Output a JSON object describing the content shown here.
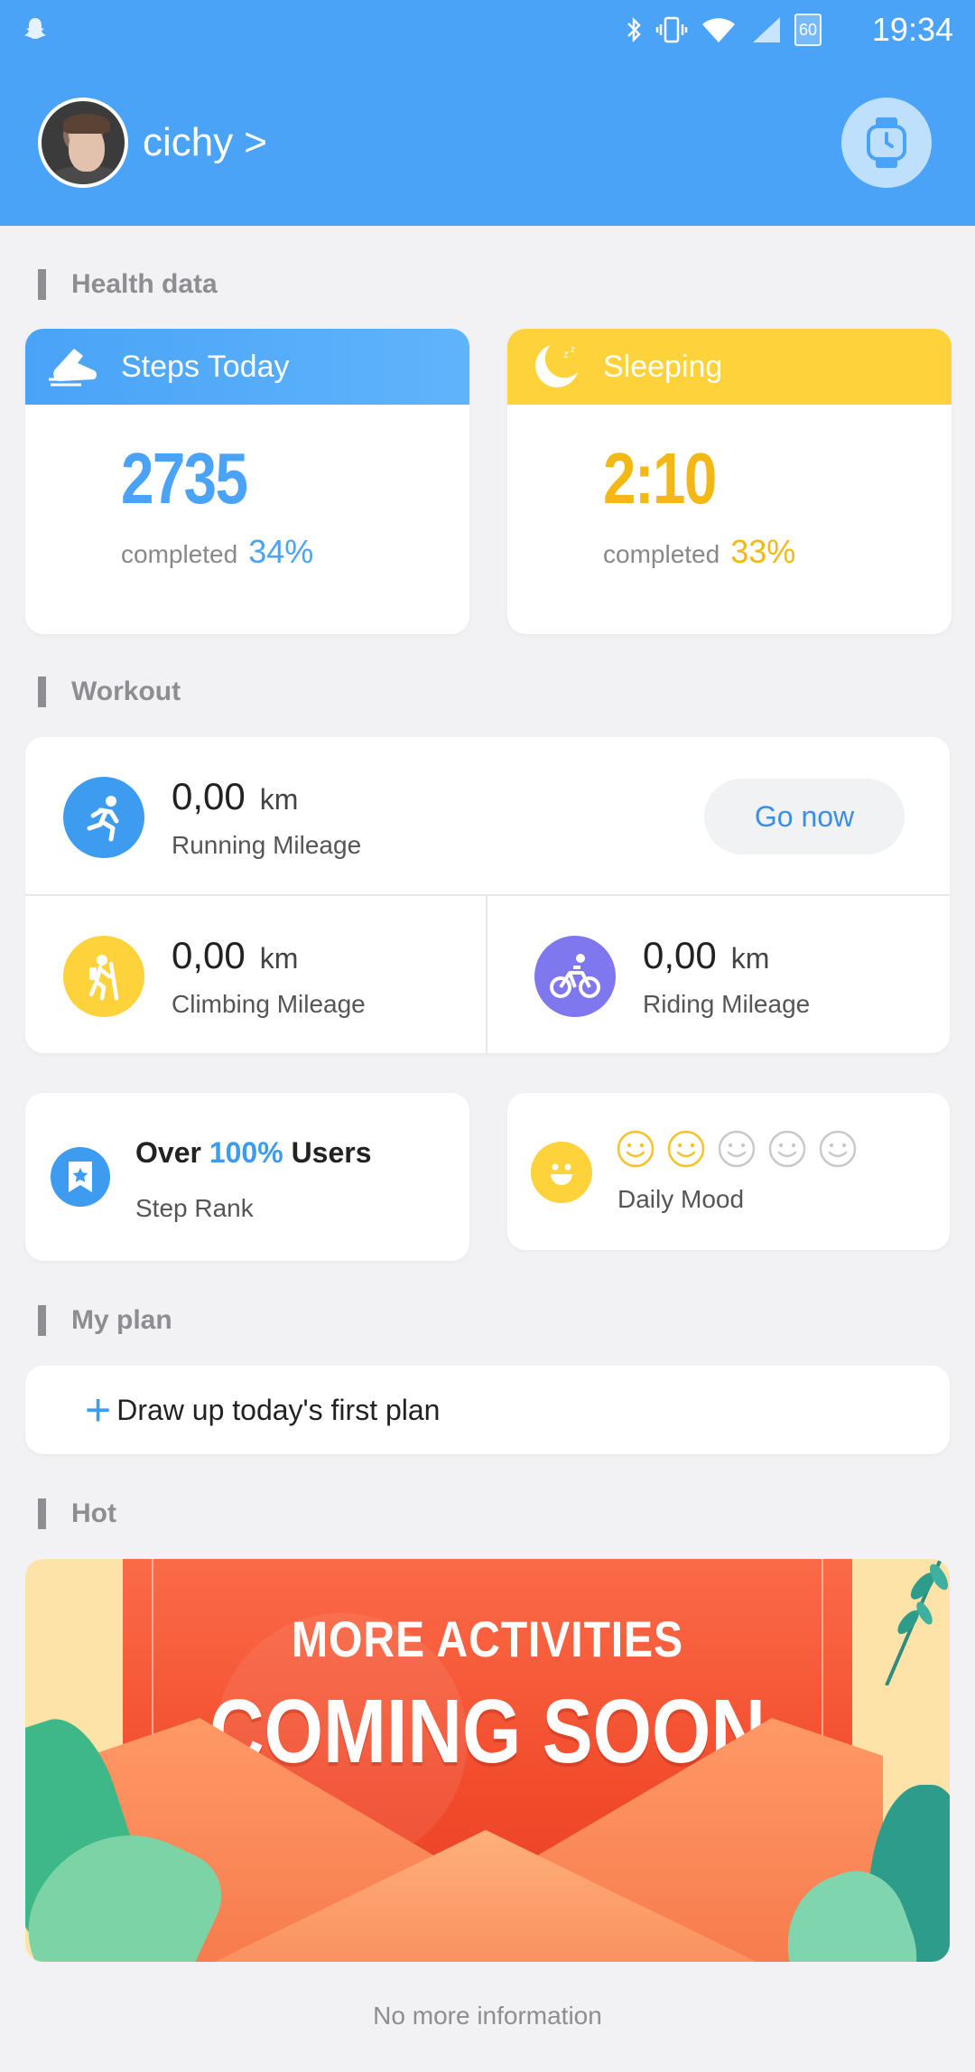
{
  "status_bar": {
    "time": "19:34",
    "battery": "60",
    "icons": [
      "snapchat-icon",
      "bluetooth-icon",
      "vibrate-icon",
      "wifi-icon",
      "signal-icon",
      "battery-icon"
    ]
  },
  "header": {
    "username": "cichy",
    "chevron": ">",
    "background_color": "#4aa3f7"
  },
  "sections": {
    "health": "Health data",
    "workout": "Workout",
    "plan": "My plan",
    "hot": "Hot"
  },
  "health": {
    "steps": {
      "title": "Steps Today",
      "value": "2735",
      "completed_label": "completed",
      "percent": "34%",
      "color": "#4aa3f7"
    },
    "sleep": {
      "title": "Sleeping",
      "value": "2:10",
      "completed_label": "completed",
      "percent": "33%",
      "color": "#f3b816"
    }
  },
  "workout": {
    "running": {
      "value": "0,00",
      "unit": "km",
      "label": "Running Mileage"
    },
    "go_now": "Go now",
    "climbing": {
      "value": "0,00",
      "unit": "km",
      "label": "Climbing Mileage"
    },
    "riding": {
      "value": "0,00",
      "unit": "km",
      "label": "Riding Mileage"
    }
  },
  "rank": {
    "prefix": "Over",
    "percent": "100%",
    "suffix": "Users",
    "label": "Step Rank"
  },
  "mood": {
    "label": "Daily Mood",
    "rating": 2,
    "max": 5
  },
  "plan": {
    "add_label": "Draw up today's first plan"
  },
  "banner": {
    "line1": "MORE ACTIVITIES",
    "line2": "COMING SOON"
  },
  "footer": "No more information"
}
